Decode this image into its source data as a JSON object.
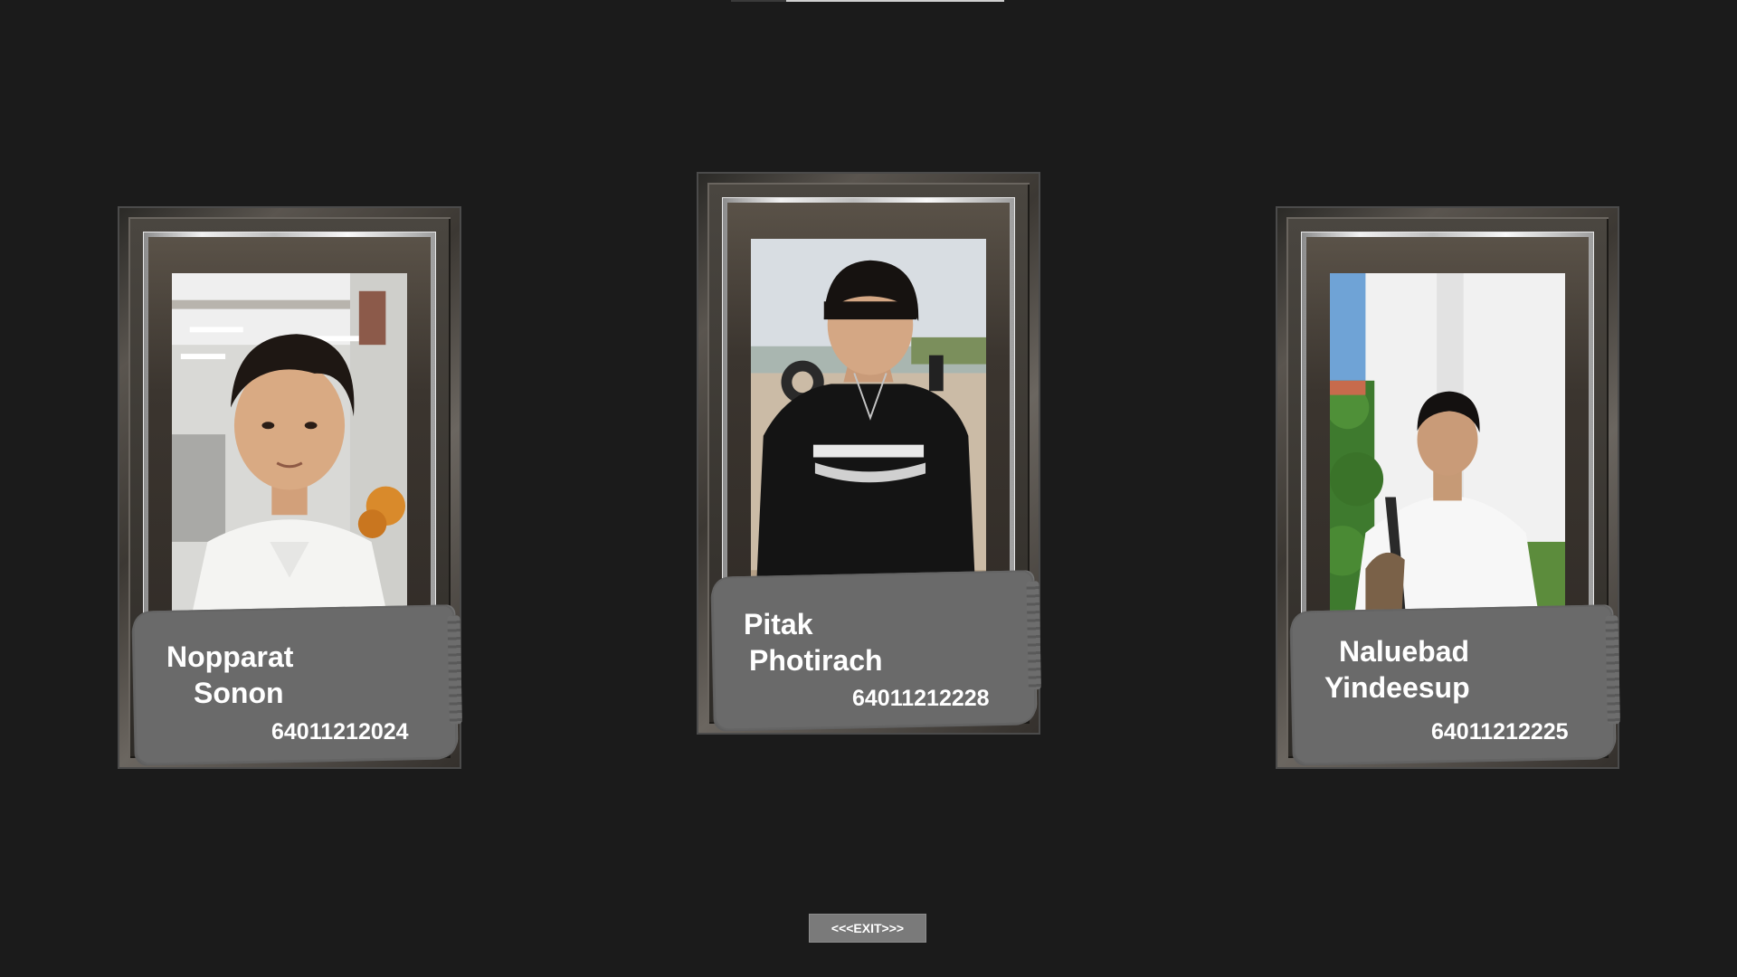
{
  "members": [
    {
      "first_name": "Nopparat",
      "last_name": "Sonon",
      "student_id": "64011212024"
    },
    {
      "first_name": "Pitak",
      "last_name": "Photirach",
      "student_id": "64011212228"
    },
    {
      "first_name": "Naluebad",
      "last_name": "Yindeesup",
      "student_id": "64011212225"
    }
  ],
  "exit_button": {
    "label": "<<<EXIT>>>"
  },
  "colors": {
    "background": "#1b1b1b",
    "plate": "#6a6a6a",
    "button": "#7a7a7a",
    "text": "#ffffff"
  }
}
